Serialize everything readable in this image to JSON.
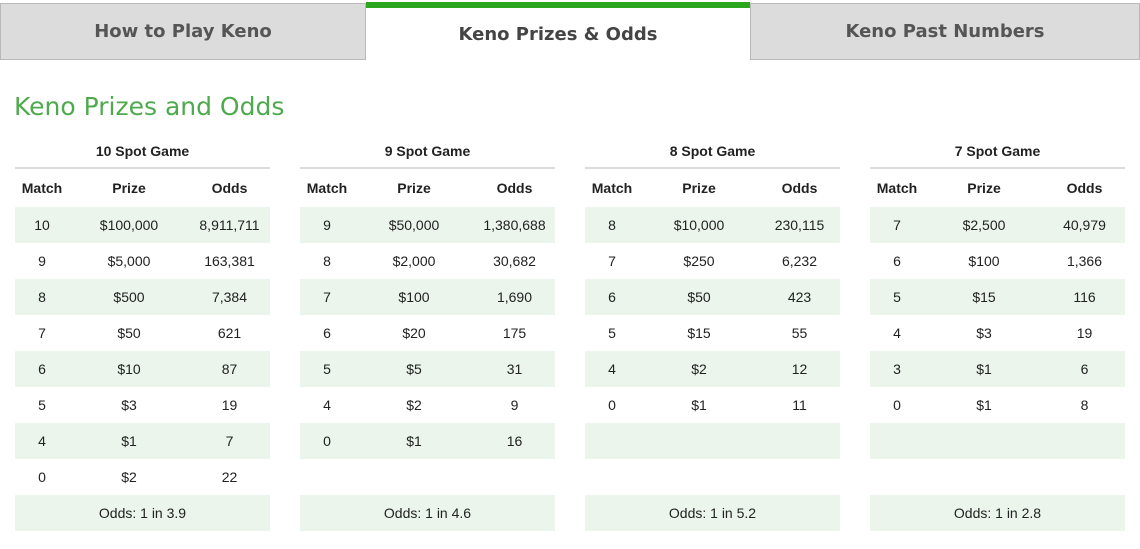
{
  "tabs": [
    {
      "label": "How to Play Keno",
      "active": false
    },
    {
      "label": "Keno Prizes & Odds",
      "active": true
    },
    {
      "label": "Keno Past Numbers",
      "active": false
    }
  ],
  "colors": {
    "accent": "#2ca51f",
    "title": "#4eaa4c",
    "row_shade": "#ebf5ec",
    "tab_bg": "#dcdcdc"
  },
  "page_title": "Keno Prizes and Odds",
  "headers": {
    "match": "Match",
    "prize": "Prize",
    "odds": "Odds"
  },
  "games": [
    {
      "title": "10 Spot Game",
      "rows": [
        {
          "match": "10",
          "prize": "$100,000",
          "odds": "8,911,711"
        },
        {
          "match": "9",
          "prize": "$5,000",
          "odds": "163,381"
        },
        {
          "match": "8",
          "prize": "$500",
          "odds": "7,384"
        },
        {
          "match": "7",
          "prize": "$50",
          "odds": "621"
        },
        {
          "match": "6",
          "prize": "$10",
          "odds": "87"
        },
        {
          "match": "5",
          "prize": "$3",
          "odds": "19"
        },
        {
          "match": "4",
          "prize": "$1",
          "odds": "7"
        },
        {
          "match": "0",
          "prize": "$2",
          "odds": "22"
        }
      ],
      "overall_odds": "Odds: 1 in 3.9"
    },
    {
      "title": "9 Spot Game",
      "rows": [
        {
          "match": "9",
          "prize": "$50,000",
          "odds": "1,380,688"
        },
        {
          "match": "8",
          "prize": "$2,000",
          "odds": "30,682"
        },
        {
          "match": "7",
          "prize": "$100",
          "odds": "1,690"
        },
        {
          "match": "6",
          "prize": "$20",
          "odds": "175"
        },
        {
          "match": "5",
          "prize": "$5",
          "odds": "31"
        },
        {
          "match": "4",
          "prize": "$2",
          "odds": "9"
        },
        {
          "match": "0",
          "prize": "$1",
          "odds": "16"
        }
      ],
      "overall_odds": "Odds: 1 in 4.6"
    },
    {
      "title": "8 Spot Game",
      "rows": [
        {
          "match": "8",
          "prize": "$10,000",
          "odds": "230,115"
        },
        {
          "match": "7",
          "prize": "$250",
          "odds": "6,232"
        },
        {
          "match": "6",
          "prize": "$50",
          "odds": "423"
        },
        {
          "match": "5",
          "prize": "$15",
          "odds": "55"
        },
        {
          "match": "4",
          "prize": "$2",
          "odds": "12"
        },
        {
          "match": "0",
          "prize": "$1",
          "odds": "11"
        }
      ],
      "overall_odds": "Odds: 1 in 5.2"
    },
    {
      "title": "7 Spot Game",
      "rows": [
        {
          "match": "7",
          "prize": "$2,500",
          "odds": "40,979"
        },
        {
          "match": "6",
          "prize": "$100",
          "odds": "1,366"
        },
        {
          "match": "5",
          "prize": "$15",
          "odds": "116"
        },
        {
          "match": "4",
          "prize": "$3",
          "odds": "19"
        },
        {
          "match": "3",
          "prize": "$1",
          "odds": "6"
        },
        {
          "match": "0",
          "prize": "$1",
          "odds": "8"
        }
      ],
      "overall_odds": "Odds: 1 in 2.8"
    }
  ]
}
